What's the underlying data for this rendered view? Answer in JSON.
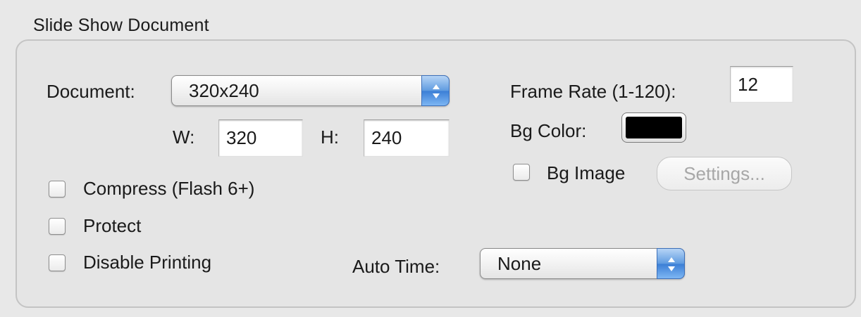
{
  "group": {
    "title": "Slide Show Document"
  },
  "document": {
    "label": "Document:",
    "selected": "320x240",
    "width_label": "W:",
    "width_value": "320",
    "height_label": "H:",
    "height_value": "240"
  },
  "frame_rate": {
    "label": "Frame Rate (1-120):",
    "value": "12"
  },
  "bg_color": {
    "label": "Bg Color:",
    "color": "#000000"
  },
  "bg_image": {
    "label": "Bg Image",
    "checked": false,
    "settings_label": "Settings..."
  },
  "options": [
    {
      "label": "Compress (Flash 6+)",
      "checked": false
    },
    {
      "label": "Protect",
      "checked": false
    },
    {
      "label": "Disable Printing",
      "checked": false
    }
  ],
  "auto_time": {
    "label": "Auto Time:",
    "selected": "None"
  }
}
